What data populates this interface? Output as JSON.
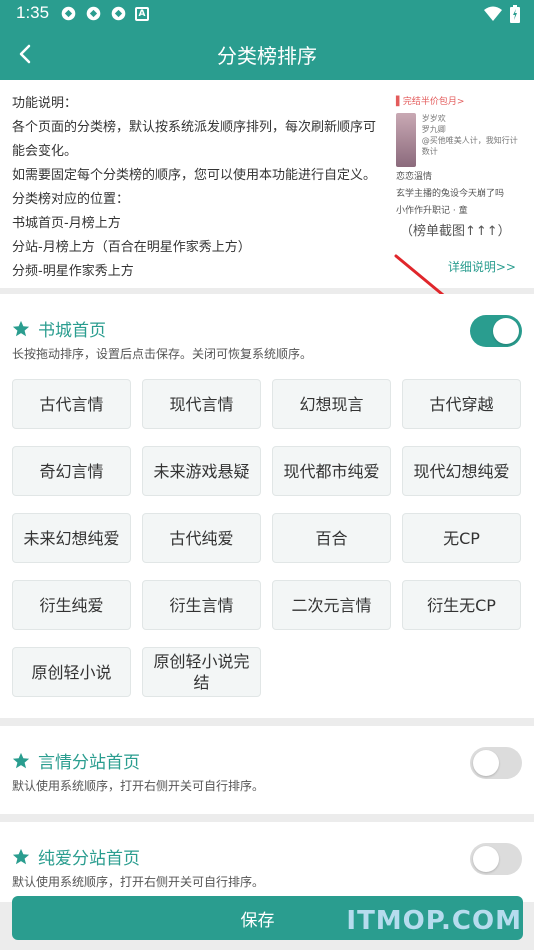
{
  "status_bar": {
    "time": "1:35"
  },
  "app_bar": {
    "title": "分类榜排序"
  },
  "info": {
    "lines": [
      "功能说明：",
      "各个页面的分类榜，默认按系统派发顺序排列，每次刷新顺序可",
      "能会变化。",
      "如需要固定每个分类榜的顺序，您可以使用本功能进行自定义。",
      "分类榜对应的位置：",
      "书城首页-月榜上方",
      "分站-月榜上方（百合在明星作家秀上方）",
      "分频-明星作家秀上方"
    ],
    "preview": {
      "top": "▌完结半价包月>",
      "book_title": "岁岁欢",
      "book_author": "罗九卿",
      "book_blurb": "@买他唯美人计，我知行计数计",
      "line1": "恋恋溫情",
      "line2": "玄学主播的兔设今天崩了吗",
      "line3": "小作作升职记 · 童"
    },
    "caption": "（榜单截图↑↑↑）",
    "detail_link": "详细说明>>"
  },
  "sections": [
    {
      "title": "书城首页",
      "desc": "长按拖动排序，设置后点击保存。关闭可恢复系统顺序。",
      "enabled": true,
      "categories": [
        "古代言情",
        "现代言情",
        "幻想现言",
        "古代穿越",
        "奇幻言情",
        "未来游戏悬疑",
        "现代都市纯爱",
        "现代幻想纯爱",
        "未来幻想纯爱",
        "古代纯爱",
        "百合",
        "无CP",
        "衍生纯爱",
        "衍生言情",
        "二次元言情",
        "衍生无CP",
        "原创轻小说",
        "原创轻小说完结"
      ]
    },
    {
      "title": "言情分站首页",
      "desc": "默认使用系统顺序，打开右侧开关可自行排序。",
      "enabled": false
    },
    {
      "title": "纯爱分站首页",
      "desc": "默认使用系统顺序，打开右侧开关可自行排序。",
      "enabled": false
    }
  ],
  "save_label": "保存",
  "watermark": "ITMOP.COM",
  "colors": {
    "accent": "#2a9d8f",
    "chip_bg": "#f3f6f6",
    "toggle_off": "#dcdcdc",
    "arrow": "#e0262b"
  },
  "icons": [
    "back-arrow-icon",
    "star-icon",
    "wifi-icon",
    "battery-icon"
  ]
}
